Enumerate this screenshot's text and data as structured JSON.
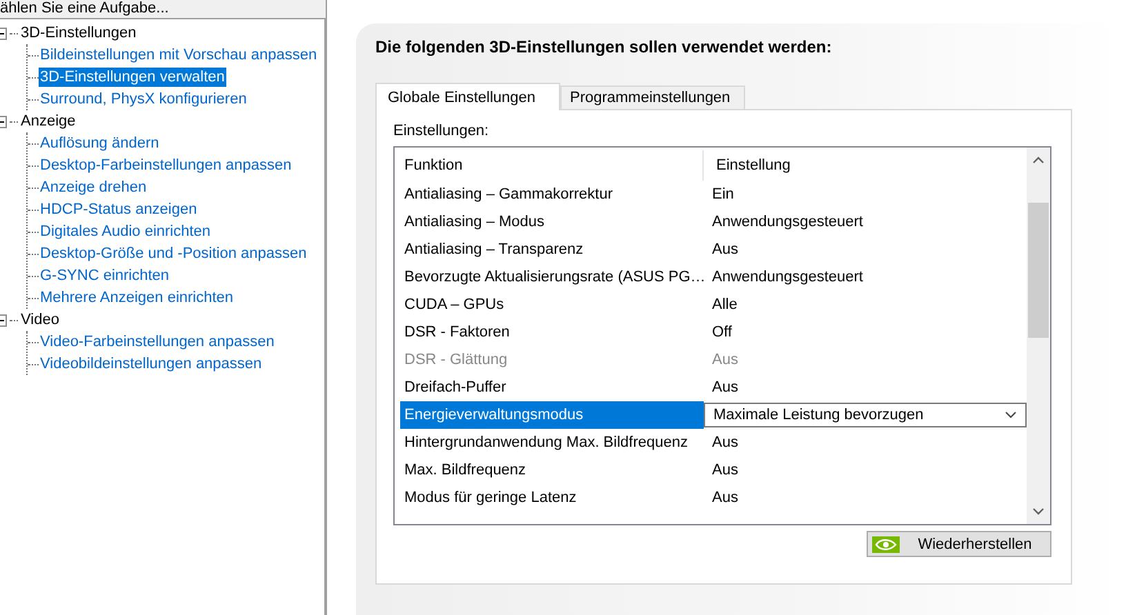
{
  "task_prompt": "ählen Sie eine Aufgabe...",
  "tree": [
    {
      "label": "3D-Einstellungen",
      "expanded": true,
      "children": [
        {
          "label": "Bildeinstellungen mit Vorschau anpassen",
          "selected": false
        },
        {
          "label": "3D-Einstellungen verwalten",
          "selected": true
        },
        {
          "label": "Surround, PhysX konfigurieren",
          "selected": false
        }
      ]
    },
    {
      "label": "Anzeige",
      "expanded": true,
      "children": [
        {
          "label": "Auflösung ändern",
          "selected": false
        },
        {
          "label": "Desktop-Farbeinstellungen anpassen",
          "selected": false
        },
        {
          "label": "Anzeige drehen",
          "selected": false
        },
        {
          "label": "HDCP-Status anzeigen",
          "selected": false
        },
        {
          "label": "Digitales Audio einrichten",
          "selected": false
        },
        {
          "label": "Desktop-Größe und -Position anpassen",
          "selected": false
        },
        {
          "label": "G-SYNC einrichten",
          "selected": false
        },
        {
          "label": "Mehrere Anzeigen einrichten",
          "selected": false
        }
      ]
    },
    {
      "label": "Video",
      "expanded": true,
      "children": [
        {
          "label": "Video-Farbeinstellungen anpassen",
          "selected": false
        },
        {
          "label": "Videobildeinstellungen anpassen",
          "selected": false
        }
      ]
    }
  ],
  "panel": {
    "title": "Die folgenden 3D-Einstellungen sollen verwendet werden:",
    "tabs": [
      {
        "label": "Globale Einstellungen",
        "selected": true
      },
      {
        "label": "Programmeinstellungen",
        "selected": false
      }
    ],
    "settings_label": "Einstellungen:",
    "table": {
      "columns": [
        "Funktion",
        "Einstellung"
      ],
      "rows": [
        {
          "function": "Antialiasing – Gammakorrektur",
          "setting": "Ein",
          "disabled": false,
          "selected": false
        },
        {
          "function": "Antialiasing – Modus",
          "setting": "Anwendungsgesteuert",
          "disabled": false,
          "selected": false
        },
        {
          "function": "Antialiasing – Transparenz",
          "setting": "Aus",
          "disabled": false,
          "selected": false
        },
        {
          "function": "Bevorzugte Aktualisierungsrate (ASUS PG…",
          "setting": "Anwendungsgesteuert",
          "disabled": false,
          "selected": false
        },
        {
          "function": "CUDA – GPUs",
          "setting": "Alle",
          "disabled": false,
          "selected": false
        },
        {
          "function": "DSR - Faktoren",
          "setting": "Off",
          "disabled": false,
          "selected": false
        },
        {
          "function": "DSR - Glättung",
          "setting": "Aus",
          "disabled": true,
          "selected": false
        },
        {
          "function": "Dreifach-Puffer",
          "setting": "Aus",
          "disabled": false,
          "selected": false
        },
        {
          "function": "Energieverwaltungsmodus",
          "setting": "Maximale Leistung bevorzugen",
          "disabled": false,
          "selected": true
        },
        {
          "function": "Hintergrundanwendung Max. Bildfrequenz",
          "setting": "Aus",
          "disabled": false,
          "selected": false
        },
        {
          "function": "Max. Bildfrequenz",
          "setting": "Aus",
          "disabled": false,
          "selected": false
        },
        {
          "function": "Modus für geringe Latenz",
          "setting": "Aus",
          "disabled": false,
          "selected": false
        }
      ]
    },
    "restore_button": "Wiederherstellen"
  }
}
